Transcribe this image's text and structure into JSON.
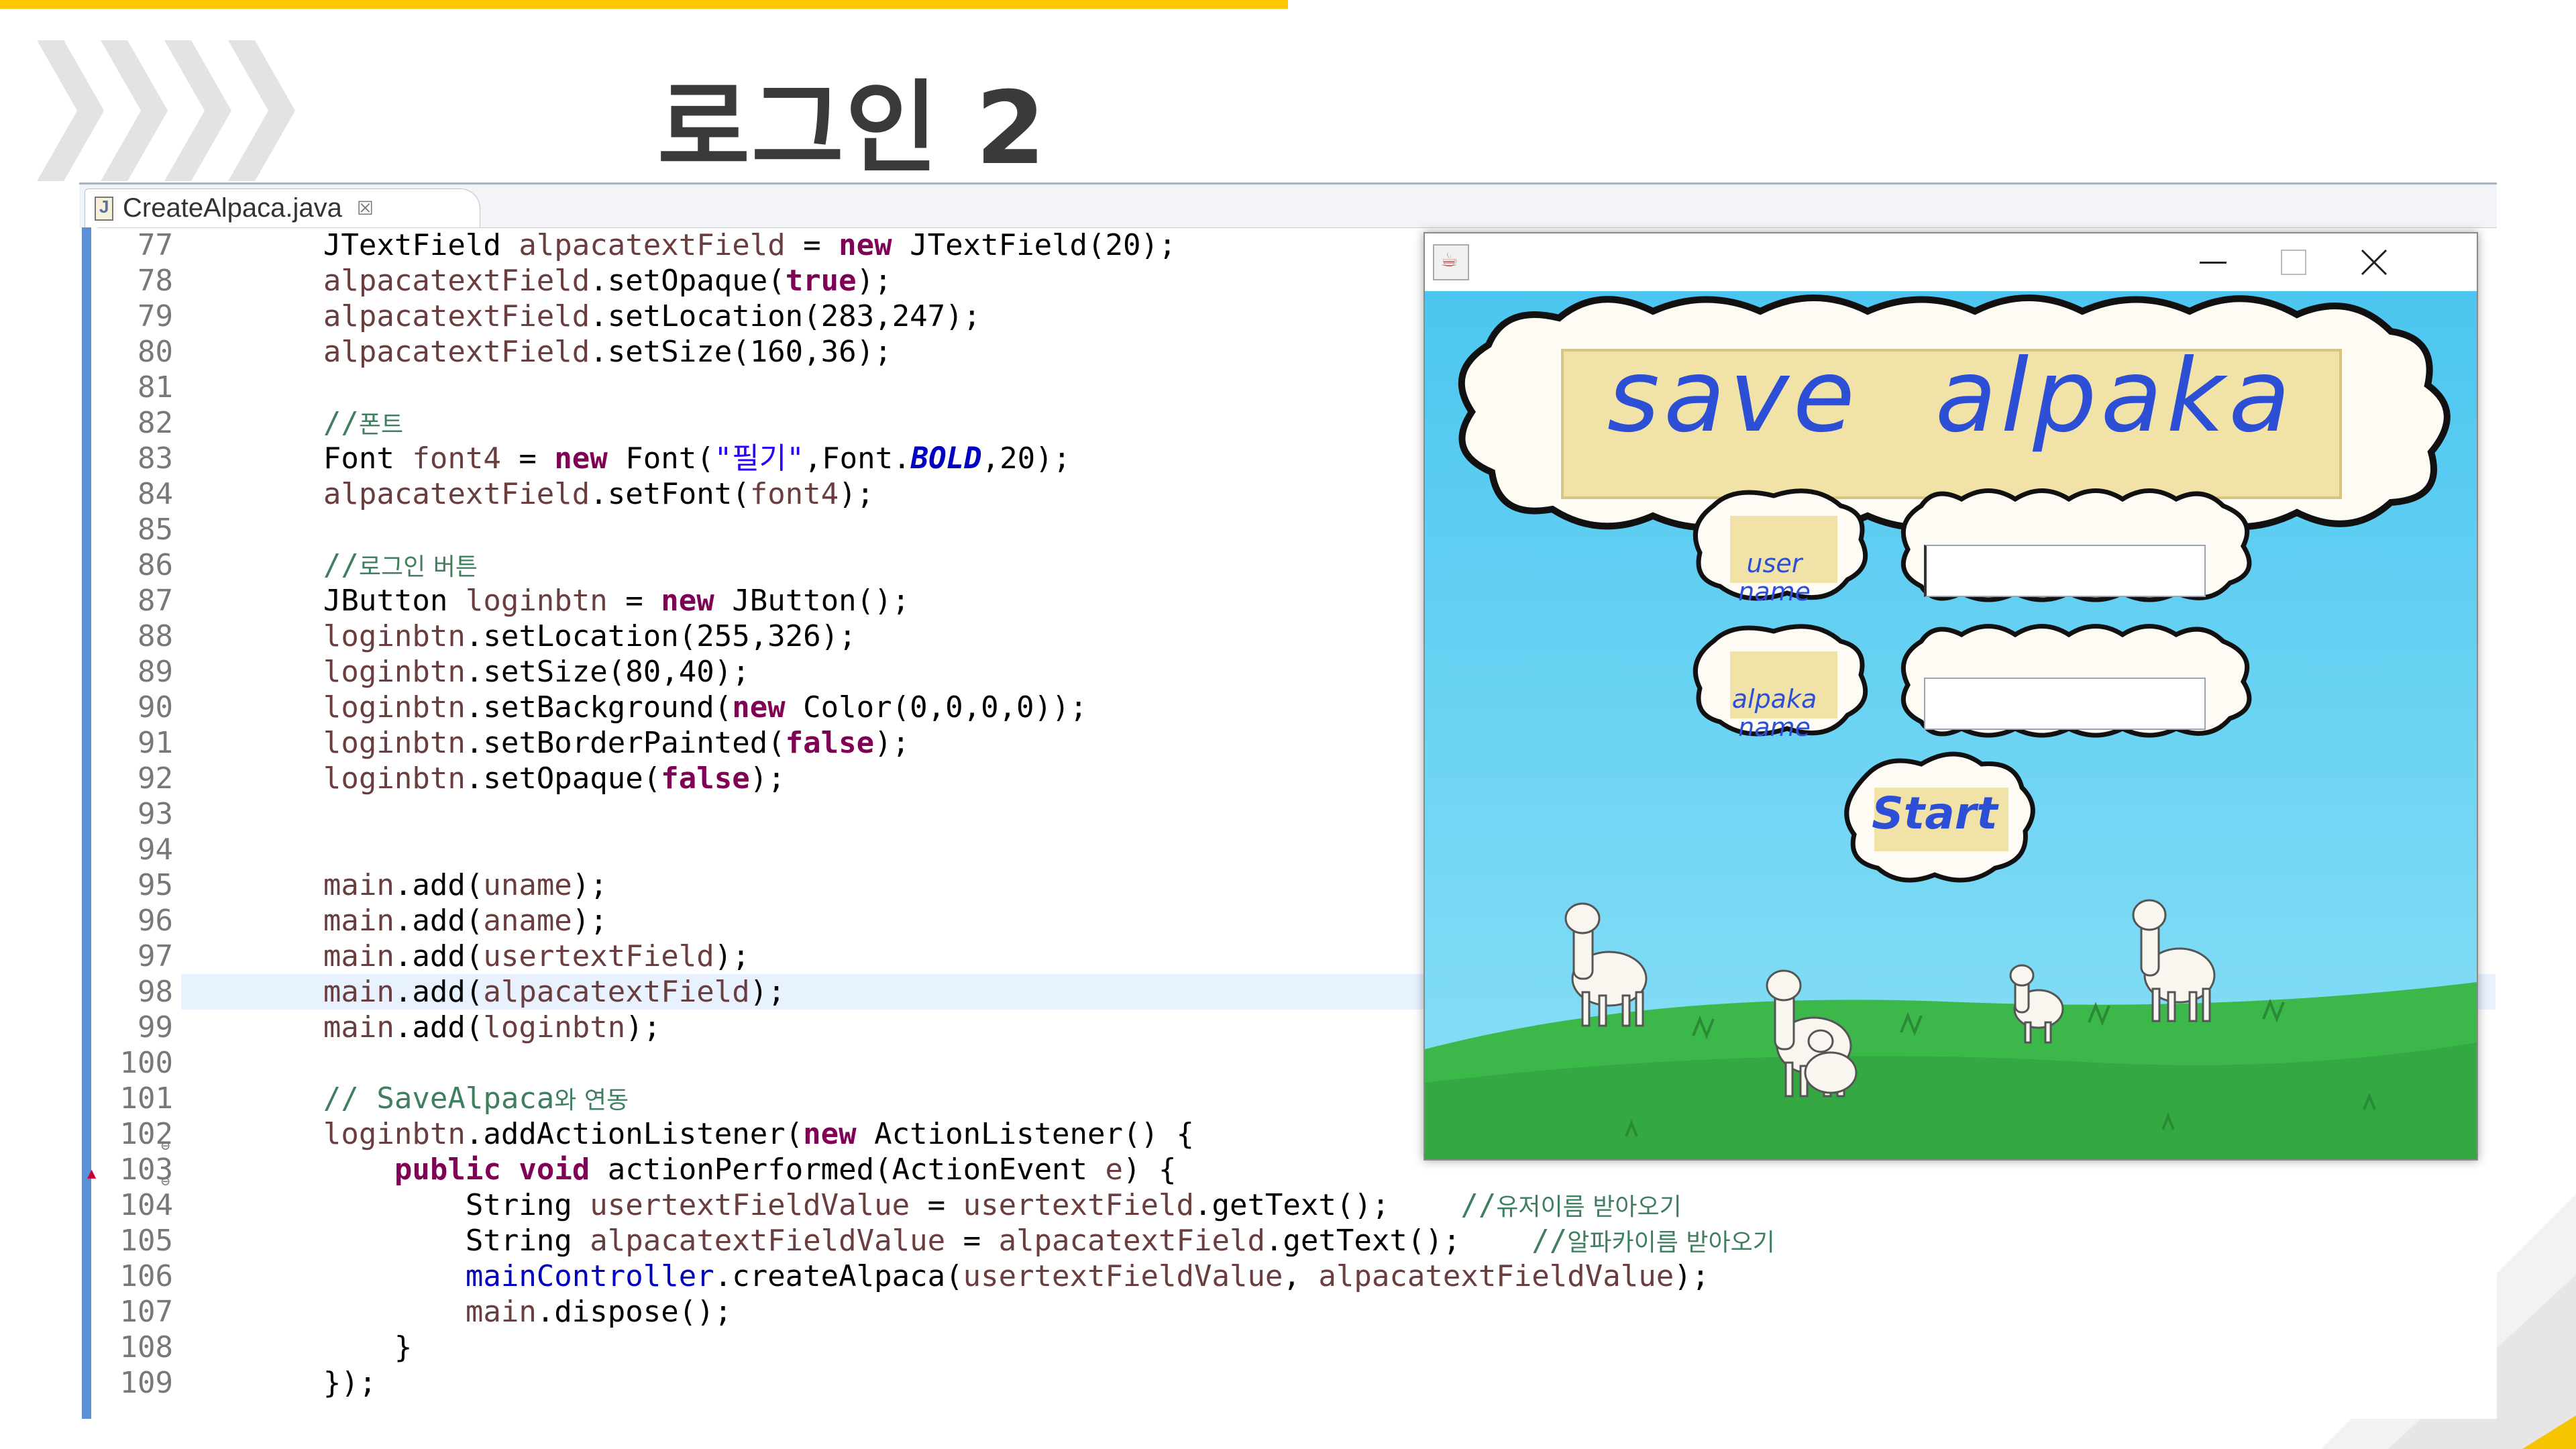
{
  "slide": {
    "title": "로그인 2",
    "accent_color": "#fbc800"
  },
  "editor": {
    "tab_label": "CreateAlpaca.java",
    "tab_close_glyph": "☒",
    "highlighted_line": "98"
  },
  "code_lines": [
    {
      "n": "77",
      "text": "        JTextField alpacatextField = new JTextField(20);"
    },
    {
      "n": "78",
      "text": "        alpacatextField.setOpaque(true);"
    },
    {
      "n": "79",
      "text": "        alpacatextField.setLocation(283,247);"
    },
    {
      "n": "80",
      "text": "        alpacatextField.setSize(160,36);"
    },
    {
      "n": "81",
      "text": ""
    },
    {
      "n": "82",
      "text": "        //폰트"
    },
    {
      "n": "83",
      "text": "        Font font4 = new Font(\"필기\",Font.BOLD,20);"
    },
    {
      "n": "84",
      "text": "        alpacatextField.setFont(font4);"
    },
    {
      "n": "85",
      "text": ""
    },
    {
      "n": "86",
      "text": "        //로그인 버튼"
    },
    {
      "n": "87",
      "text": "        JButton loginbtn = new JButton();"
    },
    {
      "n": "88",
      "text": "        loginbtn.setLocation(255,326);"
    },
    {
      "n": "89",
      "text": "        loginbtn.setSize(80,40);"
    },
    {
      "n": "90",
      "text": "        loginbtn.setBackground(new Color(0,0,0,0));"
    },
    {
      "n": "91",
      "text": "        loginbtn.setBorderPainted(false);"
    },
    {
      "n": "92",
      "text": "        loginbtn.setOpaque(false);"
    },
    {
      "n": "93",
      "text": ""
    },
    {
      "n": "94",
      "text": ""
    },
    {
      "n": "95",
      "text": "        main.add(uname);"
    },
    {
      "n": "96",
      "text": "        main.add(aname);"
    },
    {
      "n": "97",
      "text": "        main.add(usertextField);"
    },
    {
      "n": "98",
      "text": "        main.add(alpacatextField);"
    },
    {
      "n": "99",
      "text": "        main.add(loginbtn);"
    },
    {
      "n": "100",
      "text": ""
    },
    {
      "n": "101",
      "text": "        // SaveAlpaca와 연동"
    },
    {
      "n": "102",
      "text": "        loginbtn.addActionListener(new ActionListener() {"
    },
    {
      "n": "103",
      "text": "            public void actionPerformed(ActionEvent e) {"
    },
    {
      "n": "104",
      "text": "                String usertextFieldValue = usertextField.getText();    //유저이름 받아오기"
    },
    {
      "n": "105",
      "text": "                String alpacatextFieldValue = alpacatextField.getText();    //알파카이름 받아오기"
    },
    {
      "n": "106",
      "text": "                mainController.createAlpaca(usertextFieldValue, alpacatextFieldValue);"
    },
    {
      "n": "107",
      "text": "                main.dispose();"
    },
    {
      "n": "108",
      "text": "            }"
    },
    {
      "n": "109",
      "text": "        });"
    }
  ],
  "app_window": {
    "banner": "save alpaka",
    "user_label_line1": "user",
    "user_label_line2": "name",
    "alpaka_label_line1": "alpaka",
    "alpaka_label_line2": "name",
    "user_input_value": "",
    "alpaka_input_value": "",
    "start_button": "Start",
    "minimize_glyph": "─",
    "close_glyph": "✕",
    "sky_color": "#5fd0f2",
    "grass_color": "#3cb84a"
  }
}
